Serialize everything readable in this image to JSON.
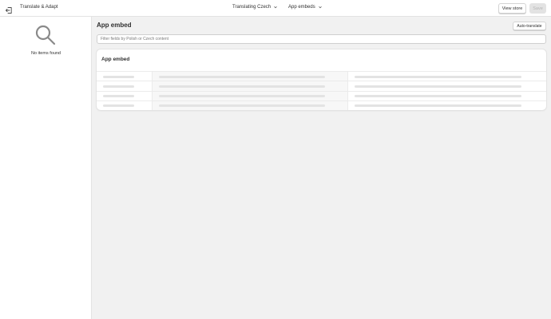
{
  "topbar": {
    "app_title": "Translate & Adapt",
    "language_selector": "Translating Czech",
    "resource_selector": "App embeds",
    "view_store_label": "View store",
    "save_label": "Save"
  },
  "sidebar": {
    "empty_state_icon": "search-icon",
    "empty_text": "No items found"
  },
  "main": {
    "title": "App embed",
    "auto_translate_label": "Auto-translate",
    "filter_placeholder": "Filter fields by Polish or Czech content",
    "card": {
      "title": "App embed",
      "rows": 4
    }
  },
  "icons": {
    "back": "exit-icon",
    "chevron": "chevron-down-icon"
  },
  "colors": {
    "background": "#f1f1f1",
    "surface": "#ffffff",
    "border": "#e3e3e3",
    "text": "#303030",
    "skeleton": "#e3e3e3"
  }
}
